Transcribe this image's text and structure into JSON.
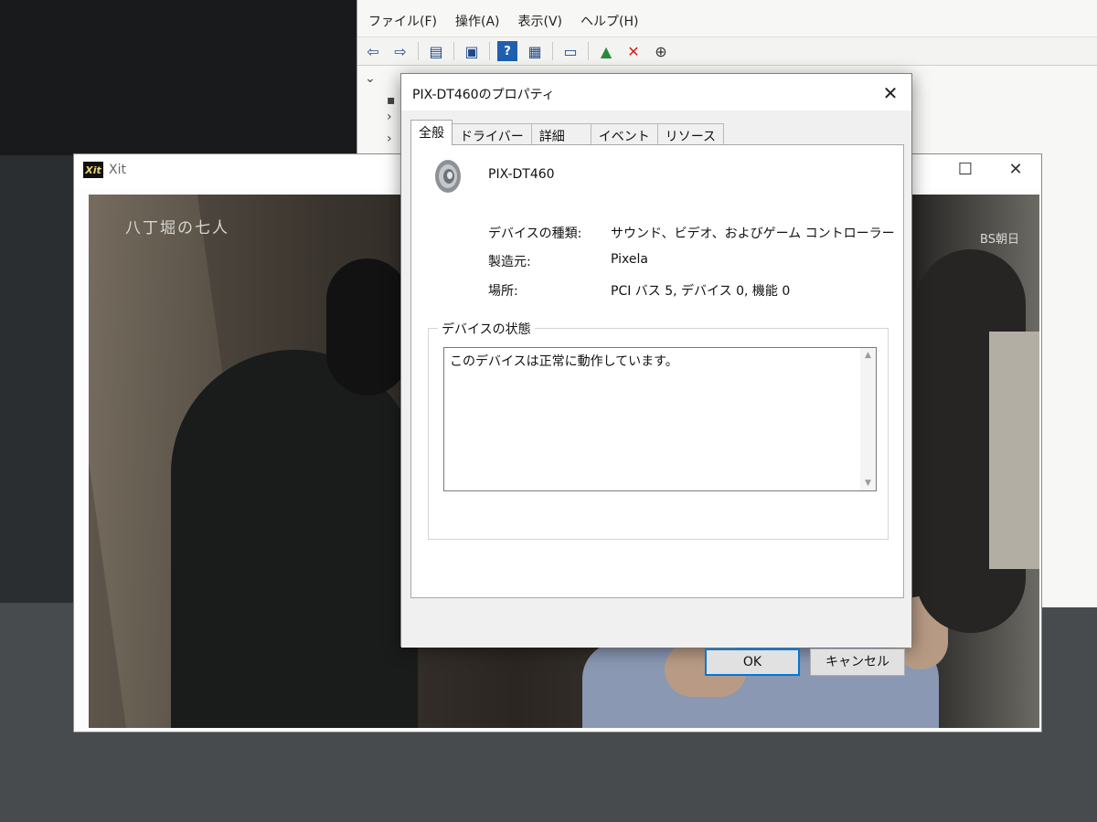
{
  "device_manager": {
    "menu": [
      "ファイル(F)",
      "操作(A)",
      "表示(V)",
      "ヘルプ(H)"
    ]
  },
  "xit": {
    "title": "Xit",
    "logo": "Xit",
    "controls": {
      "minimize": "—",
      "maximize": "☐",
      "close": "✕"
    },
    "caption": "八丁堀の七人",
    "channel": "BS朝日"
  },
  "dialog": {
    "title": "PIX-DT460のプロパティ",
    "tabs": [
      "全般",
      "ドライバー",
      "詳細",
      "イベント",
      "リソース"
    ],
    "active_tab": "全般",
    "device_name": "PIX-DT460",
    "properties": [
      {
        "label": "デバイスの種類:",
        "value": "サウンド、ビデオ、およびゲーム コントローラー"
      },
      {
        "label": "製造元:",
        "value": "Pixela"
      },
      {
        "label": "場所:",
        "value": "PCI バス 5, デバイス 0, 機能 0"
      }
    ],
    "status_group_label": "デバイスの状態",
    "status_text": "このデバイスは正常に動作しています。",
    "ok_label": "OK",
    "cancel_label": "キャンセル"
  }
}
